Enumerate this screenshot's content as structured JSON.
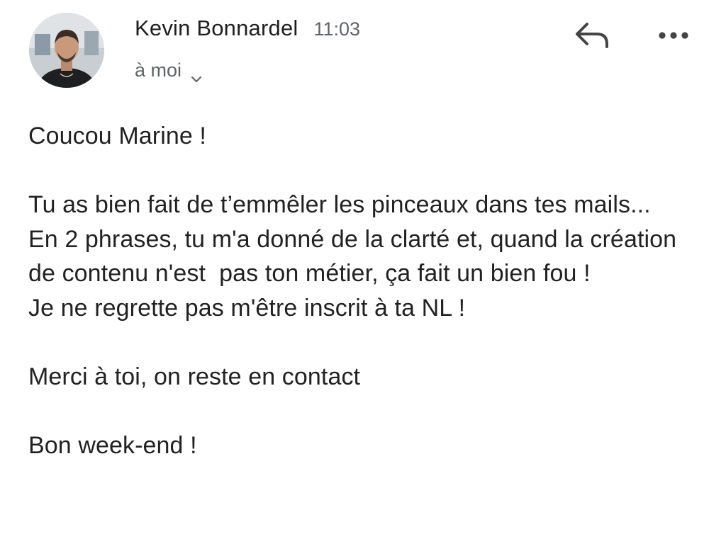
{
  "message": {
    "sender": {
      "name": "Kevin Bonnardel",
      "time": "11:03",
      "avatar_icon": "user-avatar-photo"
    },
    "recipient_label": "à moi",
    "actions": {
      "reply_icon": "reply-arrow-icon",
      "more_icon": "more-horizontal-icon"
    },
    "body": {
      "greeting": "Coucou Marine !",
      "paragraph_1": "Tu as bien fait de t’emmêler les pinceaux dans tes mails...\nEn 2 phrases, tu m'a donné de la clarté et, quand la création de contenu n'est  pas ton métier, ça fait un bien fou !\nJe ne regrette pas m'être inscrit à ta NL !",
      "closing_1": "Merci à toi, on reste en contact",
      "closing_2": "Bon week-end !"
    }
  },
  "colors": {
    "text": "#222222",
    "secondary_text": "#5f6368",
    "icon": "#444444",
    "background": "#ffffff"
  }
}
